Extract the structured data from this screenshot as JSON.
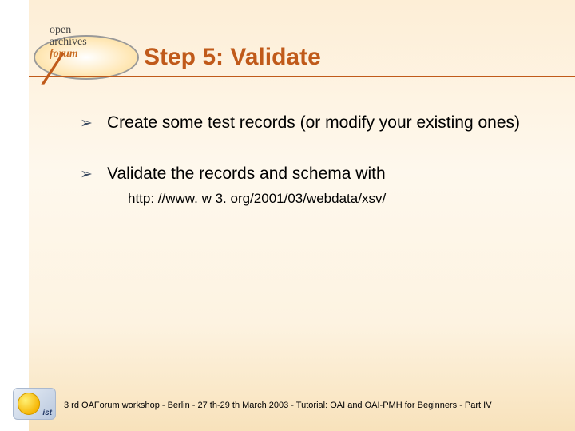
{
  "logo": {
    "line1": "open",
    "line2": "archives",
    "line3": "forum",
    "slash": "/"
  },
  "title": "Step 5: Validate",
  "bullets": [
    {
      "text": "Create some test records (or modify your existing ones)"
    },
    {
      "text": "Validate the records and schema with",
      "sub": "http: //www. w 3. org/2001/03/webdata/xsv/"
    }
  ],
  "arrow_char": "➢",
  "footer": "3 rd OAForum workshop - Berlin - 27 th-29 th March 2003 - Tutorial: OAI and OAI-PMH for Beginners - Part IV",
  "footer_logo": "ist"
}
